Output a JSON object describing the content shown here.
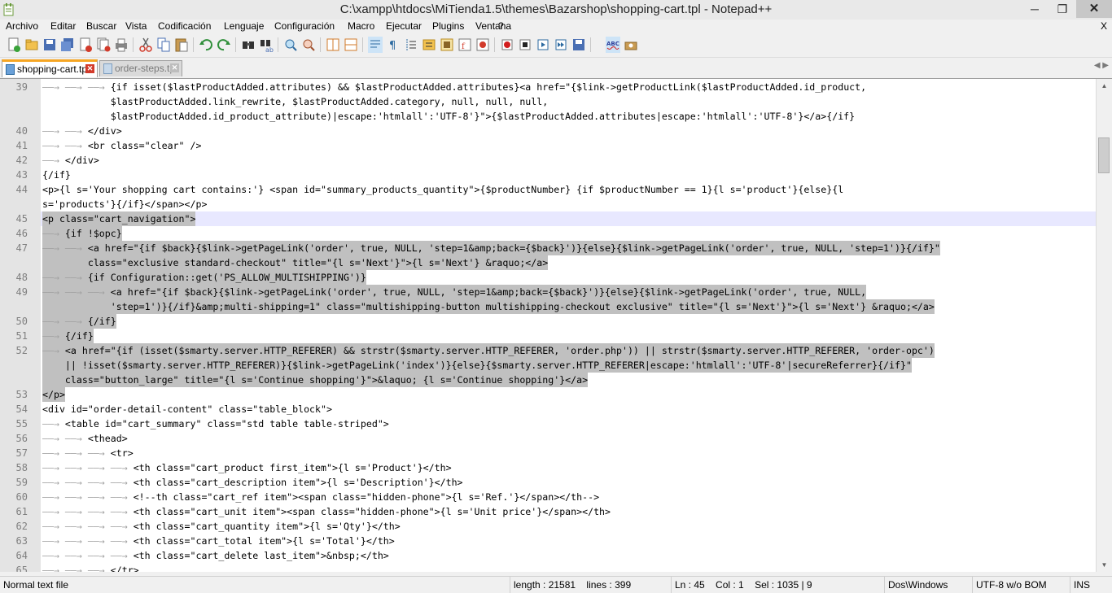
{
  "window": {
    "title": "C:\\xampp\\htdocs\\MiTienda1.5\\themes\\Bazarshop\\shopping-cart.tpl - Notepad++",
    "minimize_glyph": "─",
    "maximize_glyph": "❐",
    "close_glyph": "✕"
  },
  "menu": {
    "items": [
      "Archivo",
      "Editar",
      "Buscar",
      "Vista",
      "Codificación",
      "Lenguaje",
      "Configuración",
      "Macro",
      "Ejecutar",
      "Plugins",
      "Ventana",
      "?"
    ],
    "close_glyph": "X"
  },
  "toolbar": {
    "buttons": [
      "new-file-icon",
      "open-file-icon",
      "save-icon",
      "save-all-icon",
      "close-icon",
      "close-all-icon",
      "print-icon",
      "cut-icon",
      "copy-icon",
      "paste-icon",
      "undo-icon",
      "redo-icon",
      "find-icon",
      "replace-icon",
      "zoom-in-icon",
      "zoom-out-icon",
      "sync-vertical-icon",
      "sync-horizontal-icon",
      "word-wrap-icon",
      "show-all-characters-icon",
      "indent-guide-icon",
      "user-defined-language-icon",
      "document-map-icon",
      "function-list-icon",
      "folder-as-workspace-icon",
      "record-macro-icon",
      "stop-recording-icon",
      "playback-macro-icon",
      "run-macro-multiple-icon",
      "save-macro-icon",
      "spell-check-icon",
      "spell-check-options-icon"
    ]
  },
  "tabs": [
    {
      "label": "shopping-cart.tpl",
      "active": true
    },
    {
      "label": "order-steps.tpl",
      "active": false
    }
  ],
  "editor": {
    "lines": [
      {
        "num": "39",
        "indent": 3,
        "text": "{if isset($lastProductAdded.attributes) && $lastProductAdded.attributes}<a href=\"{$link->getProductLink($lastProductAdded.id_product,",
        "sel": false
      },
      {
        "num": "",
        "indent": 0,
        "text": "            $lastProductAdded.link_rewrite, $lastProductAdded.category, null, null, null,",
        "sel": false
      },
      {
        "num": "",
        "indent": 0,
        "text": "            $lastProductAdded.id_product_attribute)|escape:'htmlall':'UTF-8'}\">{$lastProductAdded.attributes|escape:'htmlall':'UTF-8'}</a>{/if}",
        "sel": false
      },
      {
        "num": "40",
        "indent": 2,
        "text": "</div>",
        "sel": false
      },
      {
        "num": "41",
        "indent": 2,
        "text": "<br class=\"clear\" />",
        "sel": false
      },
      {
        "num": "42",
        "indent": 1,
        "text": "</div>",
        "sel": false
      },
      {
        "num": "43",
        "indent": 0,
        "text": "{/if}",
        "sel": false
      },
      {
        "num": "44",
        "indent": 0,
        "text": "<p>{l s='Your shopping cart contains:'} <span id=\"summary_products_quantity\">{$productNumber} {if $productNumber == 1}{l s='product'}{else}{l",
        "sel": false
      },
      {
        "num": "",
        "indent": 0,
        "text": "s='products'}{/if}</span></p>",
        "sel": false
      },
      {
        "num": "45",
        "indent": 0,
        "text": "<p class=\"cart_navigation\">",
        "sel": true,
        "current": true
      },
      {
        "num": "46",
        "indent": 1,
        "text": "{if !$opc}",
        "sel": true
      },
      {
        "num": "47",
        "indent": 2,
        "text": "<a href=\"{if $back}{$link->getPageLink('order', true, NULL, 'step=1&amp;back={$back}')}{else}{$link->getPageLink('order', true, NULL, 'step=1')}{/if}\"",
        "sel": true
      },
      {
        "num": "",
        "indent": 0,
        "text": "        class=\"exclusive standard-checkout\" title=\"{l s='Next'}\">{l s='Next'} &raquo;</a>",
        "sel": true
      },
      {
        "num": "48",
        "indent": 2,
        "text": "{if Configuration::get('PS_ALLOW_MULTISHIPPING')}",
        "sel": true
      },
      {
        "num": "49",
        "indent": 3,
        "text": "<a href=\"{if $back}{$link->getPageLink('order', true, NULL, 'step=1&amp;back={$back}')}{else}{$link->getPageLink('order', true, NULL,",
        "sel": true
      },
      {
        "num": "",
        "indent": 0,
        "text": "            'step=1')}{/if}&amp;multi-shipping=1\" class=\"multishipping-button multishipping-checkout exclusive\" title=\"{l s='Next'}\">{l s='Next'} &raquo;</a>",
        "sel": true
      },
      {
        "num": "50",
        "indent": 2,
        "text": "{/if}",
        "sel": true
      },
      {
        "num": "51",
        "indent": 1,
        "text": "{/if}",
        "sel": true
      },
      {
        "num": "52",
        "indent": 1,
        "text": "<a href=\"{if (isset($smarty.server.HTTP_REFERER) && strstr($smarty.server.HTTP_REFERER, 'order.php')) || strstr($smarty.server.HTTP_REFERER, 'order-opc')",
        "sel": true
      },
      {
        "num": "",
        "indent": 0,
        "text": "    || !isset($smarty.server.HTTP_REFERER)}{$link->getPageLink('index')}{else}{$smarty.server.HTTP_REFERER|escape:'htmlall':'UTF-8'|secureReferrer}{/if}\"",
        "sel": true
      },
      {
        "num": "",
        "indent": 0,
        "text": "    class=\"button_large\" title=\"{l s='Continue shopping'}\">&laquo; {l s='Continue shopping'}</a>",
        "sel": true
      },
      {
        "num": "53",
        "indent": 0,
        "text": "</p>",
        "sel": true
      },
      {
        "num": "54",
        "indent": 0,
        "text": "<div id=\"order-detail-content\" class=\"table_block\">",
        "sel": false
      },
      {
        "num": "55",
        "indent": 1,
        "text": "<table id=\"cart_summary\" class=\"std table table-striped\">",
        "sel": false
      },
      {
        "num": "56",
        "indent": 2,
        "text": "<thead>",
        "sel": false
      },
      {
        "num": "57",
        "indent": 3,
        "text": "<tr>",
        "sel": false
      },
      {
        "num": "58",
        "indent": 4,
        "text": "<th class=\"cart_product first_item\">{l s='Product'}</th>",
        "sel": false
      },
      {
        "num": "59",
        "indent": 4,
        "text": "<th class=\"cart_description item\">{l s='Description'}</th>",
        "sel": false
      },
      {
        "num": "60",
        "indent": 4,
        "text": "<!--th class=\"cart_ref item\"><span class=\"hidden-phone\">{l s='Ref.'}</span></th-->",
        "sel": false
      },
      {
        "num": "61",
        "indent": 4,
        "text": "<th class=\"cart_unit item\"><span class=\"hidden-phone\">{l s='Unit price'}</span></th>",
        "sel": false
      },
      {
        "num": "62",
        "indent": 4,
        "text": "<th class=\"cart_quantity item\">{l s='Qty'}</th>",
        "sel": false
      },
      {
        "num": "63",
        "indent": 4,
        "text": "<th class=\"cart_total item\">{l s='Total'}</th>",
        "sel": false
      },
      {
        "num": "64",
        "indent": 4,
        "text": "<th class=\"cart_delete last_item\">&nbsp;</th>",
        "sel": false
      },
      {
        "num": "65",
        "indent": 3,
        "text": "</tr>",
        "sel": false
      }
    ]
  },
  "scrollbar": {
    "up_glyph": "▲",
    "down_glyph": "▼"
  },
  "status": {
    "mode": "Normal text file",
    "length": "length : 21581",
    "lines": "lines : 399",
    "ln": "Ln : 45",
    "col": "Col : 1",
    "sel": "Sel : 1035 | 9",
    "eol": "Dos\\Windows",
    "encoding": "UTF-8 w/o BOM",
    "ins": "INS"
  }
}
